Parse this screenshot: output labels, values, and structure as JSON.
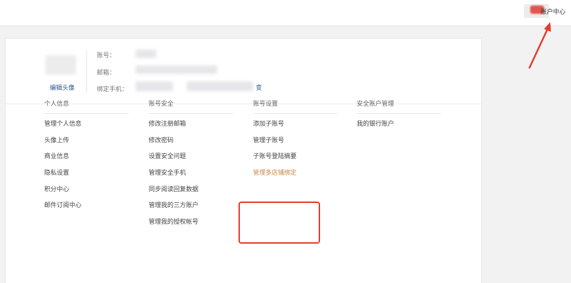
{
  "header": {
    "user_center": "账户中心",
    "accent": "#e0564c"
  },
  "profile": {
    "edit_avatar": "编辑头像",
    "account_label": "账号：",
    "email_label": "邮箱：",
    "phone_label": "绑定手机：",
    "phone_change_fragment": "变"
  },
  "columns": [
    {
      "title": "个人信息",
      "items": [
        "管理个人信息",
        "头像上传",
        "商业信息",
        "隐私设置",
        "积分中心",
        "邮件订阅中心"
      ]
    },
    {
      "title": "账号安全",
      "items": [
        "修改注册邮箱",
        "修改密码",
        "设置安全问题",
        "管理安全手机",
        "同步阅读回复数据",
        "管理我的三方账户",
        "管理我的授权帐号"
      ]
    },
    {
      "title": "账号设置",
      "items": [
        "添加子账号",
        "管理子账号",
        "子账号登陆摘要",
        "管理多店铺绑定"
      ]
    },
    {
      "title": "安全账户管理",
      "items": [
        "我的银行账户"
      ]
    }
  ],
  "highlight_color": "#c88a4a",
  "annotation_color": "#e53a2c"
}
